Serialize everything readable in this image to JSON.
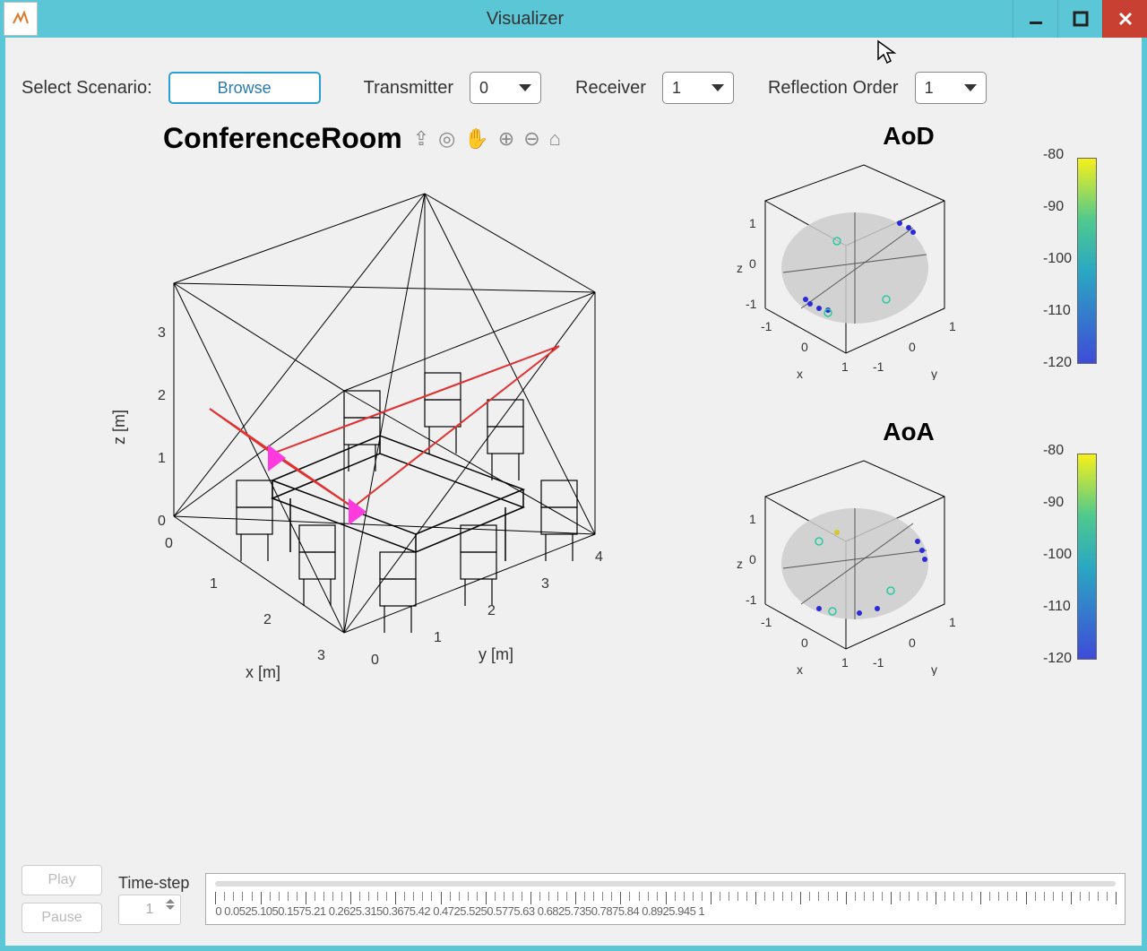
{
  "window": {
    "title": "Visualizer"
  },
  "controls": {
    "scenario_label": "Select Scenario:",
    "browse_label": "Browse",
    "transmitter_label": "Transmitter",
    "transmitter_value": "0",
    "receiver_label": "Receiver",
    "receiver_value": "1",
    "reflection_label": "Reflection Order",
    "reflection_value": "1"
  },
  "main_plot": {
    "title": "ConferenceRoom",
    "xlabel": "x [m]",
    "ylabel": "y [m]",
    "zlabel": "z [m]",
    "x_ticks": [
      "0",
      "1",
      "2",
      "3"
    ],
    "y_ticks": [
      "0",
      "1",
      "2",
      "3",
      "4"
    ],
    "z_ticks": [
      "0",
      "1",
      "2",
      "3"
    ],
    "tool_icons": [
      "export-icon",
      "rotate-icon",
      "pan-icon",
      "zoom-in-icon",
      "zoom-out-icon",
      "home-icon"
    ]
  },
  "aod_plot": {
    "title": "AoD",
    "xlabel": "x",
    "ylabel": "y",
    "zlabel": "z",
    "ticks": [
      "-1",
      "0",
      "1"
    ],
    "colorbar_ticks": [
      "-80",
      "-90",
      "-100",
      "-110",
      "-120"
    ]
  },
  "aoa_plot": {
    "title": "AoA",
    "xlabel": "x",
    "ylabel": "y",
    "zlabel": "z",
    "ticks": [
      "-1",
      "0",
      "1"
    ],
    "colorbar_ticks": [
      "-80",
      "-90",
      "-100",
      "-110",
      "-120"
    ]
  },
  "bottom": {
    "play_label": "Play",
    "pause_label": "Pause",
    "timestep_label": "Time-step",
    "timestep_value": "1",
    "ruler_text": "0 0.0525.1050.1575.21 0.2625.3150.3675.42 0.4725.5250.5775.63 0.6825.7350.7875.84 0.8925.945 1"
  },
  "chart_data": [
    {
      "type": "3d-scene",
      "title": "ConferenceRoom",
      "xlabel": "x [m]",
      "ylabel": "y [m]",
      "zlabel": "z [m]",
      "xlim": [
        0,
        3
      ],
      "ylim": [
        0,
        4
      ],
      "zlim": [
        0,
        3
      ],
      "description": "Triangulated wireframe room with conference table and 8 chairs, 3 red ray paths between two magenta antenna markers"
    },
    {
      "type": "scatter3d",
      "title": "AoD",
      "xlabel": "x",
      "ylabel": "y",
      "zlabel": "z",
      "xlim": [
        -1,
        1
      ],
      "ylim": [
        -1,
        1
      ],
      "zlim": [
        -1,
        1
      ],
      "colorbar_range": [
        -120,
        -80
      ],
      "points_approx": "clusters on unit sphere surface colored ~-100 to -115 dB"
    },
    {
      "type": "scatter3d",
      "title": "AoA",
      "xlabel": "x",
      "ylabel": "y",
      "zlabel": "z",
      "xlim": [
        -1,
        1
      ],
      "ylim": [
        -1,
        1
      ],
      "zlim": [
        -1,
        1
      ],
      "colorbar_range": [
        -120,
        -80
      ],
      "points_approx": "clusters on unit sphere surface colored ~-95 to -115 dB"
    }
  ]
}
